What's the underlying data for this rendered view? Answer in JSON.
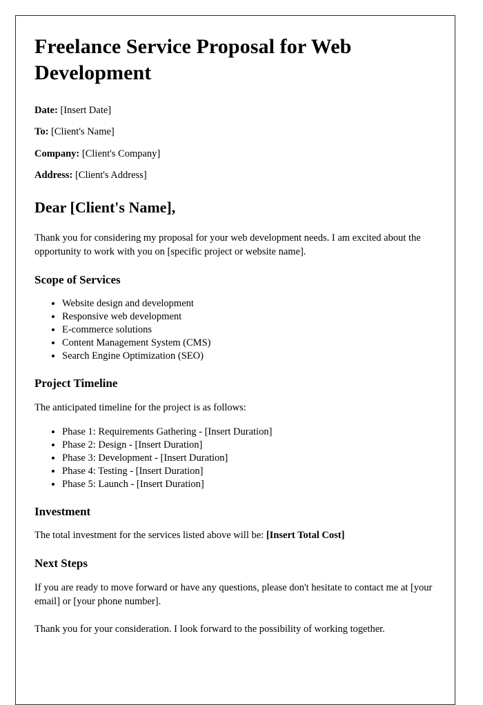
{
  "document": {
    "title": "Freelance Service Proposal for Web Development",
    "meta": [
      {
        "label": "Date:",
        "value": "[Insert Date]"
      },
      {
        "label": "To:",
        "value": "[Client's Name]"
      },
      {
        "label": "Company:",
        "value": "[Client's Company]"
      },
      {
        "label": "Address:",
        "value": "[Client's Address]"
      }
    ],
    "salutation": "Dear [Client's Name],",
    "intro_paragraph": "Thank you for considering my proposal for your web development needs. I am excited about the opportunity to work with you on [specific project or website name].",
    "sections": {
      "scope": {
        "heading": "Scope of Services",
        "items": [
          "Website design and development",
          "Responsive web development",
          "E-commerce solutions",
          "Content Management System (CMS)",
          "Search Engine Optimization (SEO)"
        ]
      },
      "timeline": {
        "heading": "Project Timeline",
        "intro": "The anticipated timeline for the project is as follows:",
        "items": [
          "Phase 1: Requirements Gathering - [Insert Duration]",
          "Phase 2: Design - [Insert Duration]",
          "Phase 3: Development - [Insert Duration]",
          "Phase 4: Testing - [Insert Duration]",
          "Phase 5: Launch - [Insert Duration]"
        ]
      },
      "investment": {
        "heading": "Investment",
        "lead_text": "The total investment for the services listed above will be: ",
        "cost_placeholder": "[Insert Total Cost]"
      },
      "next_steps": {
        "heading": "Next Steps",
        "paragraph": "If you are ready to move forward or have any questions, please don't hesitate to contact me at [your email] or [your phone number].",
        "closing_paragraph": "Thank you for your consideration. I look forward to the possibility of working together."
      }
    }
  }
}
